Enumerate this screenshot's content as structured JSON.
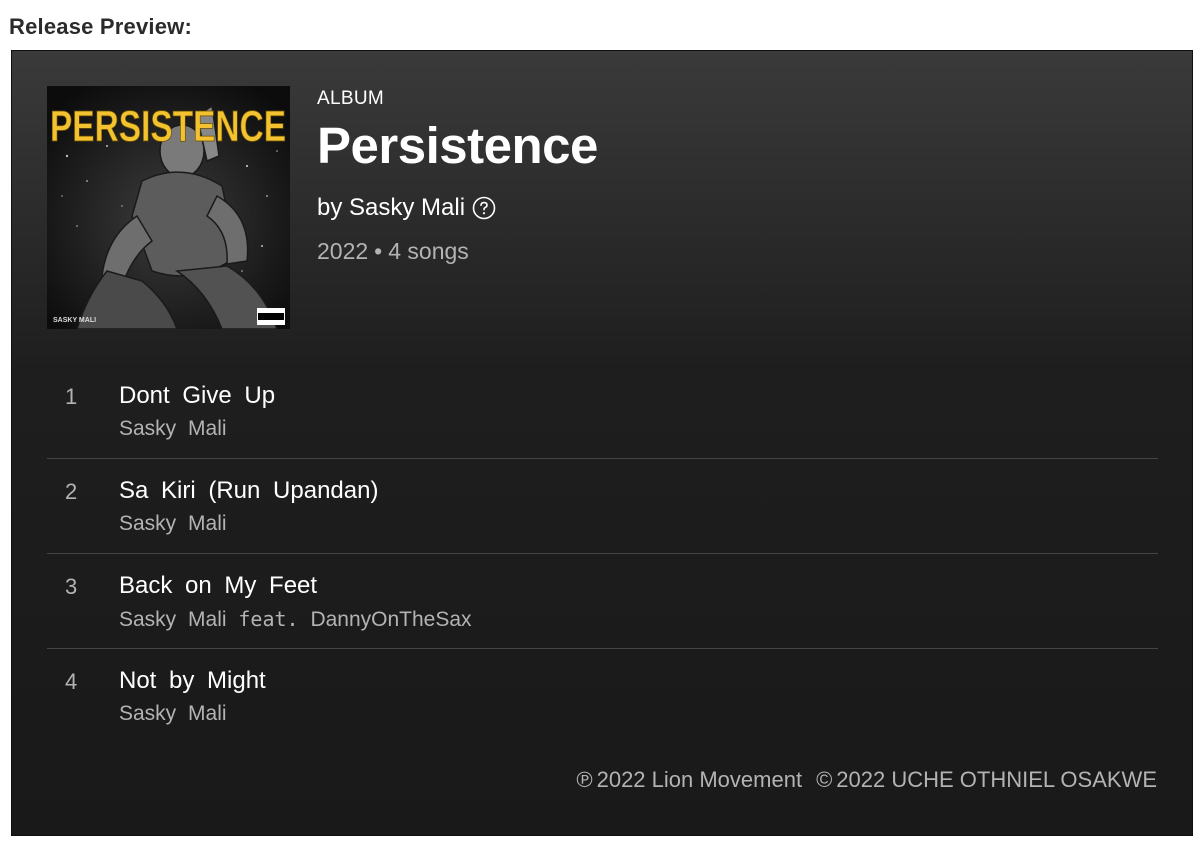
{
  "page": {
    "heading": "Release Preview:"
  },
  "release": {
    "type_label": "ALBUM",
    "title": "Persistence",
    "by_prefix": "by",
    "artist": "Sasky Mali",
    "year": "2022",
    "song_count": "4 songs",
    "cover": {
      "title_text": "PERSISTENCE",
      "artist_text": "SASKY MALI",
      "title_color": "#f2c230"
    }
  },
  "tracks": [
    {
      "number": "1",
      "title": "Dont Give Up",
      "artist": "Sasky Mali",
      "feat": "",
      "feat_artist": ""
    },
    {
      "number": "2",
      "title": "Sa Kiri (Run Upandan)",
      "artist": "Sasky Mali",
      "feat": "",
      "feat_artist": ""
    },
    {
      "number": "3",
      "title": "Back on My Feet",
      "artist": "Sasky Mali",
      "feat": "feat.",
      "feat_artist": "DannyOnTheSax"
    },
    {
      "number": "4",
      "title": "Not by Might",
      "artist": "Sasky Mali",
      "feat": "",
      "feat_artist": ""
    }
  ],
  "copyright": {
    "phonogram_symbol": "℗",
    "phonogram": "2022 Lion Movement",
    "copyright_symbol": "©",
    "copyright": "2022 UCHE OTHNIEL OSAKWE"
  },
  "icons": {
    "help": "question-circle-icon"
  }
}
